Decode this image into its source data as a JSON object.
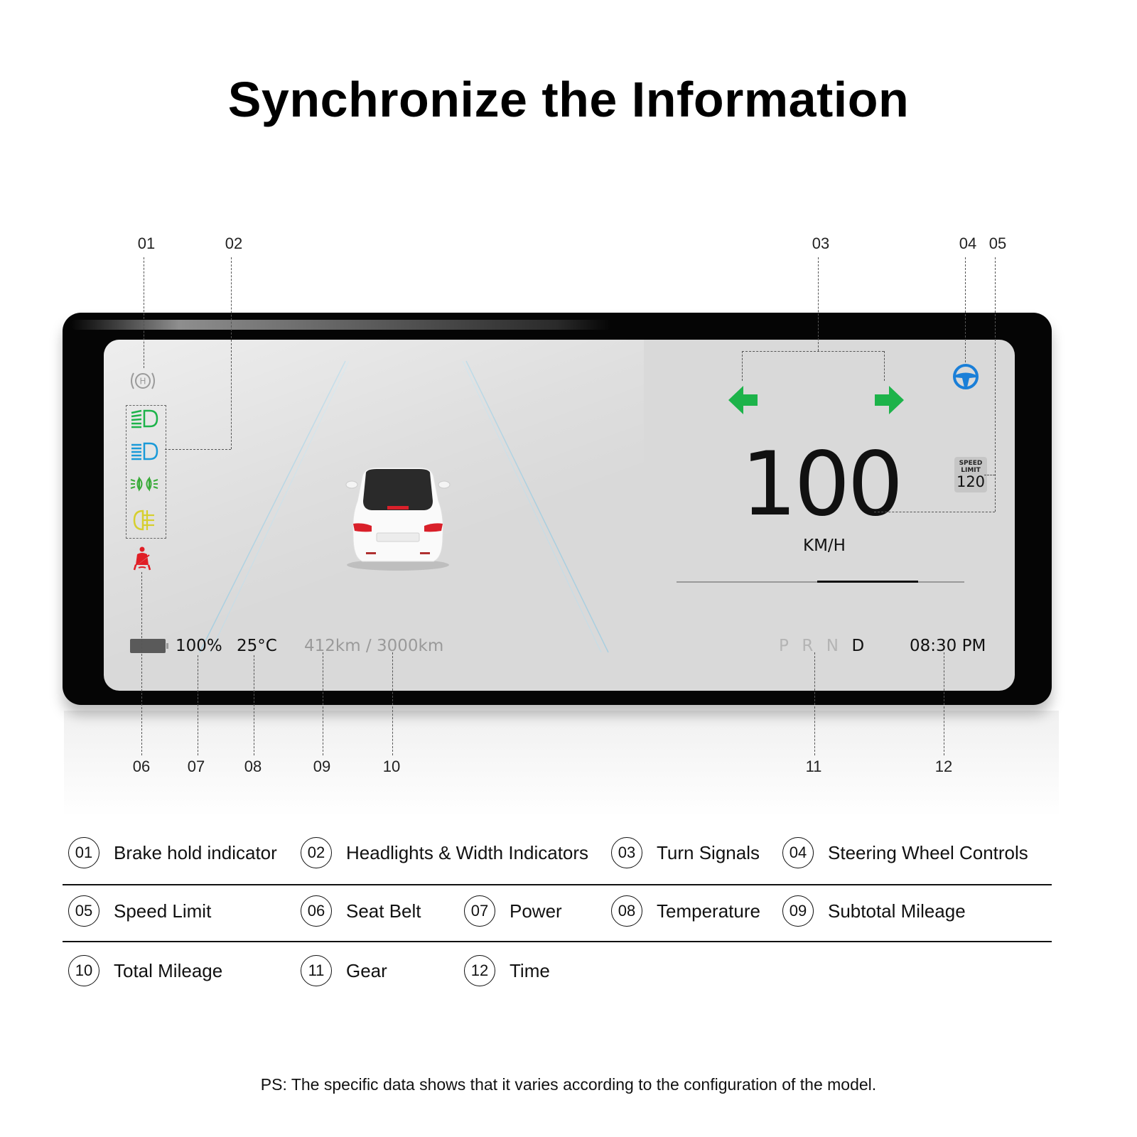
{
  "title": "Synchronize the Information",
  "callouts_top": [
    "01",
    "02",
    "03",
    "04",
    "05"
  ],
  "callouts_bottom": [
    "06",
    "07",
    "08",
    "09",
    "10",
    "11",
    "12"
  ],
  "dashboard": {
    "indicators": {
      "brake_hold": "H",
      "headlight_icons": [
        "high-beam-icon",
        "low-beam-icon",
        "width-lamp-icon",
        "fog-lamp-icon"
      ],
      "seat_belt": "seat-belt-warning-icon"
    },
    "colors": {
      "green": "#1db34a",
      "blue": "#1a7fd8",
      "yellow": "#d6cf2e",
      "red": "#e01e26",
      "screen": "#d9d9d9"
    },
    "speed": "100",
    "speed_unit": "KM/H",
    "speed_progress": 0.84,
    "speed_limit_label": "SPEED LIMIT",
    "speed_limit_value": "120",
    "battery_percent": "100%",
    "temperature": "25°C",
    "mileage": "412km / 3000km",
    "gears": [
      "P",
      "R",
      "N",
      "D"
    ],
    "active_gear": "D",
    "time": "08:30 PM"
  },
  "legend": [
    {
      "num": "01",
      "label": "Brake hold indicator"
    },
    {
      "num": "02",
      "label": "Headlights & Width Indicators"
    },
    {
      "num": "03",
      "label": "Turn Signals"
    },
    {
      "num": "04",
      "label": "Steering Wheel Controls"
    },
    {
      "num": "05",
      "label": "Speed Limit"
    },
    {
      "num": "06",
      "label": "Seat Belt"
    },
    {
      "num": "07",
      "label": "Power"
    },
    {
      "num": "08",
      "label": "Temperature"
    },
    {
      "num": "09",
      "label": "Subtotal Mileage"
    },
    {
      "num": "10",
      "label": "Total Mileage"
    },
    {
      "num": "11",
      "label": "Gear"
    },
    {
      "num": "12",
      "label": "Time"
    }
  ],
  "footnote": "PS: The specific data shows that it varies according to the configuration of the model."
}
